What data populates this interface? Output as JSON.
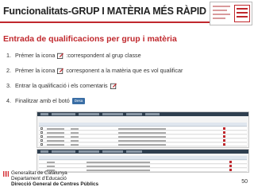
{
  "slide": {
    "title": "Funcionalitats-GRUP I MATÈRIA MÉS RÀPID",
    "subtitle": "Entrada de qualificacions per grup i matèria",
    "steps": [
      {
        "number": "1.",
        "before": "Prémer la icona",
        "after": ":correspondent al grup classe",
        "has_icon": true
      },
      {
        "number": "2.",
        "before": "Prémer la icona",
        "after": "corresponent a la matèria que es vol qualificar",
        "has_icon": true
      },
      {
        "number": "3.",
        "before": "Entrar la qualificació i els comentaris",
        "after": "",
        "has_icon": true
      },
      {
        "number": "4.",
        "before": "Finalitzar amb el botó",
        "after": "",
        "has_button": true,
        "button_label": "Desa"
      }
    ],
    "page_number": "50"
  },
  "footer": {
    "org_line1": "Generalitat de Catalunya",
    "org_line2": "Departament d'Educació",
    "org_line3": "Direcció General de Centres Públics"
  },
  "colors": {
    "accent": "#c0282d",
    "nav": "#2f3f4f",
    "button": "#3a6ea5"
  },
  "icons": [
    "edit-icon",
    "generalitat-logo"
  ]
}
